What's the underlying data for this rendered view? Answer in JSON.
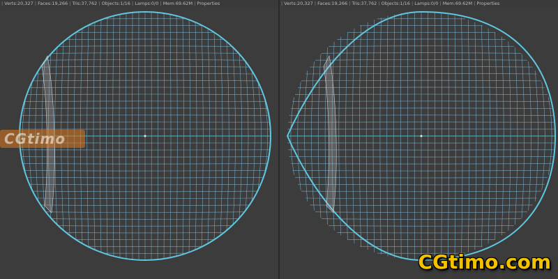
{
  "viewports": [
    {
      "stats": {
        "verts": "Verts:20,327",
        "faces": "Faces:19,266",
        "tris": "Tris:37,762",
        "objects": "Objects:1/16",
        "lamps": "Lamps:0/0",
        "mem": "Mem:69.62M",
        "properties": "Properties"
      }
    },
    {
      "stats": {
        "verts": "Verts:20,327",
        "faces": "Faces:19,266",
        "tris": "Tris:37,762",
        "objects": "Objects:1/16",
        "lamps": "Lamps:0/0",
        "mem": "Mem:69.62M",
        "properties": "Properties"
      }
    }
  ],
  "colors": {
    "wire": "#7fb9d6",
    "outline": "#5fc7e0",
    "horizon": "#33d2d9",
    "watermark": "#f2c200"
  },
  "watermarks": {
    "left_overlay": "CGtimo",
    "bottom_right": "CGtimo.com"
  }
}
